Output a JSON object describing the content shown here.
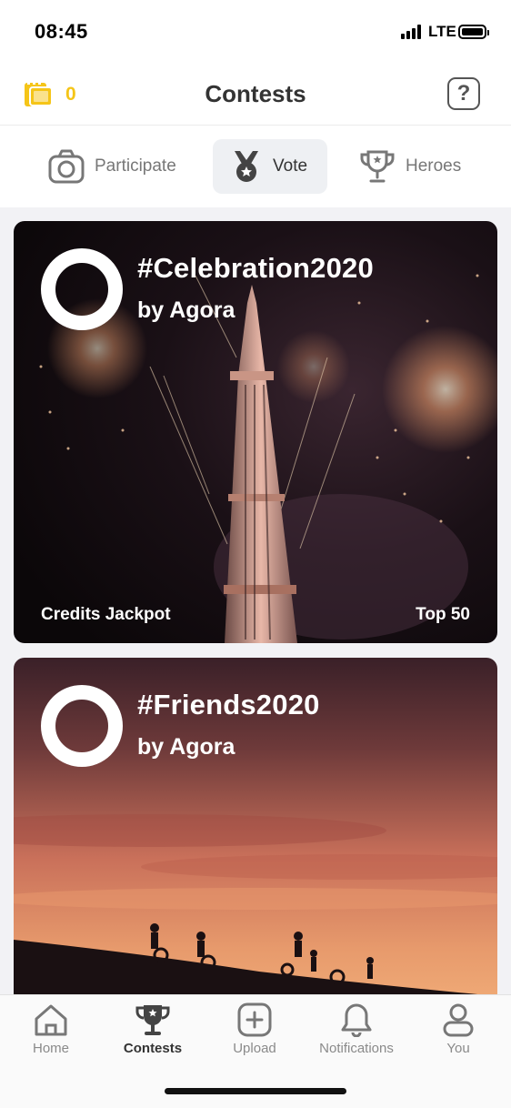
{
  "status_bar": {
    "time": "08:45",
    "network": "LTE",
    "signal_icon": "signal-bars-icon",
    "battery_icon": "battery-icon"
  },
  "header": {
    "credits_icon": "film-credits-icon",
    "credits_count": "0",
    "title": "Contests",
    "help_icon": "help-icon",
    "help_label": "?",
    "accent_color": "#f5c518"
  },
  "tabs": [
    {
      "label": "Participate",
      "icon": "camera-icon",
      "active": false
    },
    {
      "label": "Vote",
      "icon": "medal-icon",
      "active": true
    },
    {
      "label": "Heroes",
      "icon": "trophy-icon",
      "active": false
    }
  ],
  "contests": [
    {
      "title": "#Celebration2020",
      "by": "by Agora",
      "footer_left": "Credits Jackpot",
      "footer_right": "Top 50",
      "image": "fireworks over tower at night"
    },
    {
      "title": "#Friends2020",
      "by": "by Agora",
      "image": "children silhouettes on hill at sunset"
    }
  ],
  "bottom_nav": [
    {
      "label": "Home",
      "icon": "home-icon",
      "active": false
    },
    {
      "label": "Contests",
      "icon": "trophy-icon",
      "active": true
    },
    {
      "label": "Upload",
      "icon": "plus-square-icon",
      "active": false
    },
    {
      "label": "Notifications",
      "icon": "bell-icon",
      "active": false
    },
    {
      "label": "You",
      "icon": "user-icon",
      "active": false
    }
  ]
}
